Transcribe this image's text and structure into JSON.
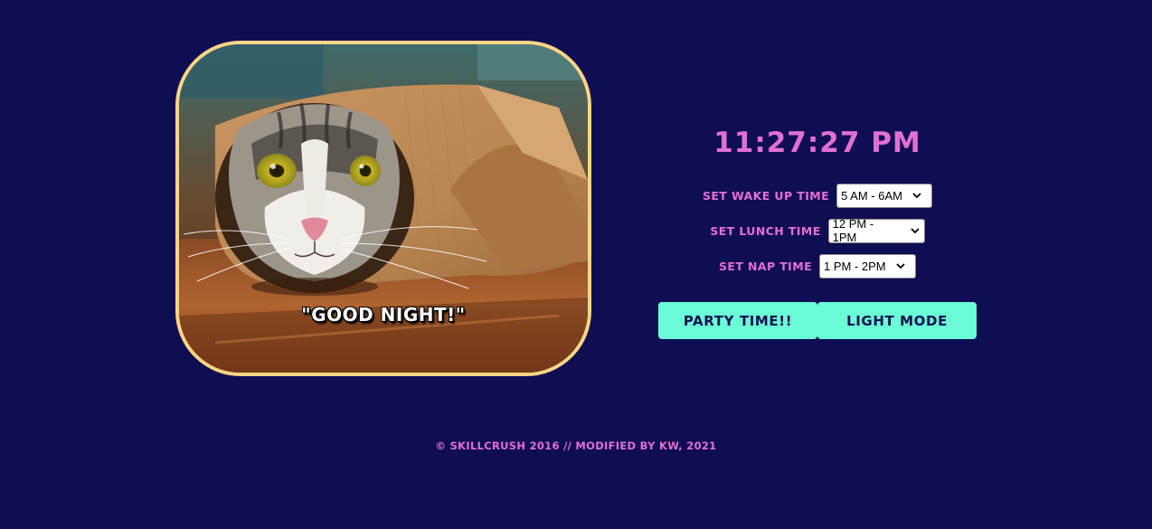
{
  "image": {
    "caption": "\"GOOD NIGHT!\"",
    "subject": "cat-in-paper-roll"
  },
  "clock": {
    "time": "11:27:27 PM"
  },
  "settings": {
    "wake": {
      "label": "SET WAKE UP TIME",
      "value": "5 AM - 6AM"
    },
    "lunch": {
      "label": "SET LUNCH TIME",
      "value": "12 PM - 1PM"
    },
    "nap": {
      "label": "SET NAP TIME",
      "value": "1 PM - 2PM"
    }
  },
  "buttons": {
    "party": "PARTY TIME!!",
    "light_mode": "LIGHT MODE"
  },
  "footer": {
    "text": "© SKILLCRUSH 2016 // MODIFIED BY KW, 2021"
  },
  "colors": {
    "background": "#0f0e52",
    "accent_pink": "#e26fd4",
    "button_teal": "#6bfcd5",
    "image_border": "#fdd585"
  }
}
